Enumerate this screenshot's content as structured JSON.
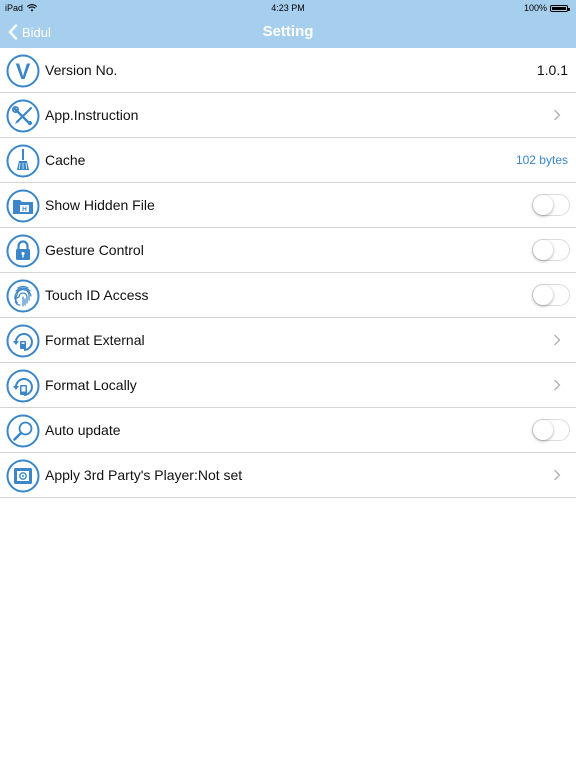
{
  "status_bar": {
    "device": "iPad",
    "time": "4:23 PM",
    "battery": "100%"
  },
  "navbar": {
    "back_label": "Bidul",
    "title": "Setting"
  },
  "colors": {
    "header_bg": "#a5cfec",
    "accent": "#3a86c8"
  },
  "rows": [
    {
      "label": "Version No.",
      "value": "1.0.1",
      "icon": "version-v-icon",
      "control": "value"
    },
    {
      "label": "App.Instruction",
      "icon": "tools-icon",
      "control": "chevron"
    },
    {
      "label": "Cache",
      "value": "102 bytes",
      "icon": "broom-icon",
      "control": "value-blue"
    },
    {
      "label": "Show Hidden File",
      "icon": "hidden-folder-icon",
      "control": "toggle",
      "on": false
    },
    {
      "label": "Gesture Control",
      "icon": "lock-icon",
      "control": "toggle",
      "on": false
    },
    {
      "label": "Touch ID Access",
      "icon": "fingerprint-icon",
      "control": "toggle",
      "on": false
    },
    {
      "label": "Format External",
      "icon": "format-external-icon",
      "control": "chevron"
    },
    {
      "label": "Format Locally",
      "icon": "format-local-icon",
      "control": "chevron"
    },
    {
      "label": "Auto update",
      "icon": "magnifier-icon",
      "control": "toggle",
      "on": false
    },
    {
      "label": "Apply 3rd Party's Player:Not set",
      "icon": "player-icon",
      "control": "chevron"
    }
  ]
}
